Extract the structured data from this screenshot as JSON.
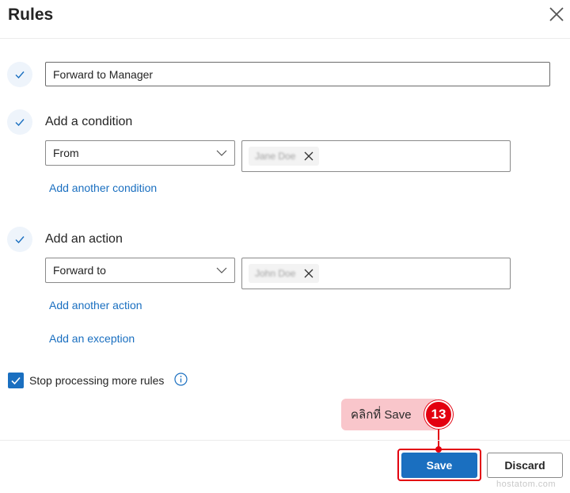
{
  "dialog": {
    "title": "Rules",
    "close_icon": "close-icon"
  },
  "rule_name": {
    "value": "Forward to Manager"
  },
  "condition": {
    "heading": "Add a condition",
    "dropdown_value": "From",
    "recipient": "Jane Doe",
    "add_link": "Add another condition"
  },
  "action": {
    "heading": "Add an action",
    "dropdown_value": "Forward to",
    "recipient": "John Doe",
    "add_link": "Add another action",
    "exception_link": "Add an exception"
  },
  "options": {
    "stop_processing_label": "Stop processing more rules",
    "stop_processing_checked": true
  },
  "annotation": {
    "callout_text": "คลิกที่ Save",
    "step_number": "13",
    "color": "#e3000f"
  },
  "footer": {
    "save_label": "Save",
    "discard_label": "Discard"
  },
  "watermark": "hostatom.com",
  "colors": {
    "accent": "#1a6fc0",
    "callout_bg": "#f9c6cb"
  }
}
